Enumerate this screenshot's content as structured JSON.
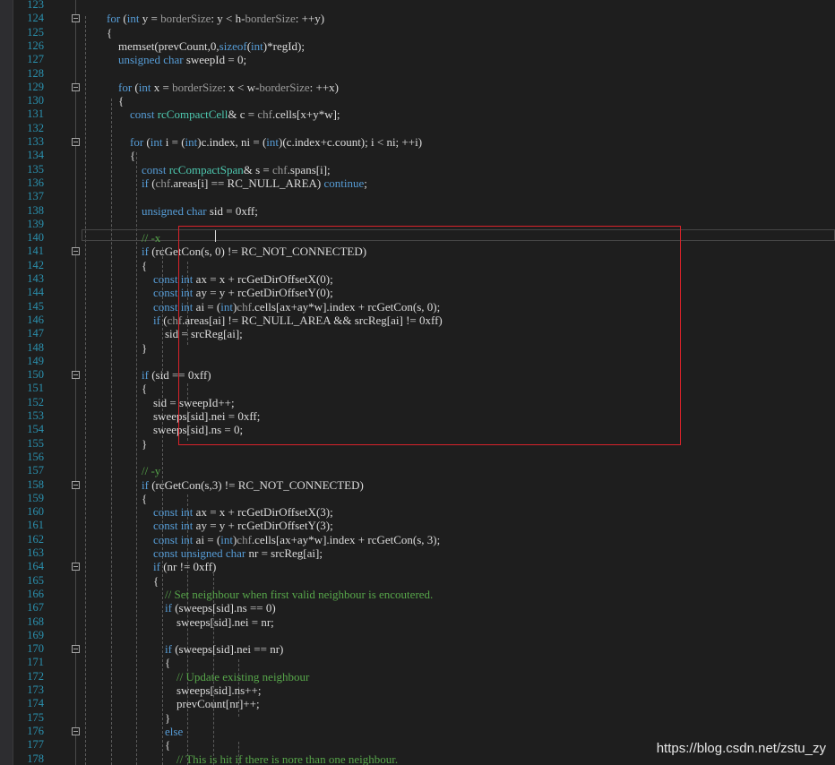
{
  "editor": {
    "colors": {
      "background": "#1e1e1e",
      "line_number": "#2b91af",
      "keyword": "#569cd6",
      "type": "#4ec9b0",
      "comment": "#57a64a",
      "member": "#9b9b9b",
      "text": "#dcdcdc",
      "highlight_border": "#d9222a"
    },
    "lines": [
      {
        "n": "123",
        "fold": false,
        "tokens": []
      },
      {
        "n": "124",
        "fold": true,
        "tokens": [
          [
            "kw",
            "for"
          ],
          [
            "fg",
            " ("
          ],
          [
            "kw",
            "int"
          ],
          [
            "fg",
            " y = "
          ],
          [
            "gv",
            "borderSize"
          ],
          [
            "fg",
            ": y < h-"
          ],
          [
            "gv",
            "borderSize"
          ],
          [
            "fg",
            ": ++y)"
          ]
        ]
      },
      {
        "n": "125",
        "fold": false,
        "tokens": [
          [
            "fg",
            "{"
          ]
        ]
      },
      {
        "n": "126",
        "fold": false,
        "tokens": [
          [
            "fg",
            "    memset(prevCount,0,"
          ],
          [
            "kw",
            "sizeof"
          ],
          [
            "fg",
            "("
          ],
          [
            "kw",
            "int"
          ],
          [
            "fg",
            ")*regId);"
          ]
        ]
      },
      {
        "n": "127",
        "fold": false,
        "tokens": [
          [
            "fg",
            "    "
          ],
          [
            "kw",
            "unsigned char"
          ],
          [
            "fg",
            " sweepId = 0;"
          ]
        ]
      },
      {
        "n": "128",
        "fold": false,
        "tokens": []
      },
      {
        "n": "129",
        "fold": true,
        "tokens": [
          [
            "fg",
            "    "
          ],
          [
            "kw",
            "for"
          ],
          [
            "fg",
            " ("
          ],
          [
            "kw",
            "int"
          ],
          [
            "fg",
            " x = "
          ],
          [
            "gv",
            "borderSize"
          ],
          [
            "fg",
            ": x < w-"
          ],
          [
            "gv",
            "borderSize"
          ],
          [
            "fg",
            ": ++x)"
          ]
        ]
      },
      {
        "n": "130",
        "fold": false,
        "tokens": [
          [
            "fg",
            "    {"
          ]
        ]
      },
      {
        "n": "131",
        "fold": false,
        "tokens": [
          [
            "fg",
            "        "
          ],
          [
            "kw",
            "const"
          ],
          [
            "fg",
            " "
          ],
          [
            "ty",
            "rcCompactCell"
          ],
          [
            "fg",
            "& c = "
          ],
          [
            "gv",
            "chf"
          ],
          [
            "fg",
            ".cells[x+y*w];"
          ]
        ]
      },
      {
        "n": "132",
        "fold": false,
        "tokens": []
      },
      {
        "n": "133",
        "fold": true,
        "tokens": [
          [
            "fg",
            "        "
          ],
          [
            "kw",
            "for"
          ],
          [
            "fg",
            " ("
          ],
          [
            "kw",
            "int"
          ],
          [
            "fg",
            " i = ("
          ],
          [
            "kw",
            "int"
          ],
          [
            "fg",
            ")c.index, ni = ("
          ],
          [
            "kw",
            "int"
          ],
          [
            "fg",
            ")(c.index+c.count); i < ni; ++i)"
          ]
        ]
      },
      {
        "n": "134",
        "fold": false,
        "tokens": [
          [
            "fg",
            "        {"
          ]
        ]
      },
      {
        "n": "135",
        "fold": false,
        "tokens": [
          [
            "fg",
            "            "
          ],
          [
            "kw",
            "const"
          ],
          [
            "fg",
            " "
          ],
          [
            "ty",
            "rcCompactSpan"
          ],
          [
            "fg",
            "& s = "
          ],
          [
            "gv",
            "chf"
          ],
          [
            "fg",
            ".spans[i];"
          ]
        ]
      },
      {
        "n": "136",
        "fold": false,
        "tokens": [
          [
            "fg",
            "            "
          ],
          [
            "kw",
            "if"
          ],
          [
            "fg",
            " ("
          ],
          [
            "gv",
            "chf"
          ],
          [
            "fg",
            ".areas[i] == RC_NULL_AREA) "
          ],
          [
            "kw",
            "continue"
          ],
          [
            "fg",
            ";"
          ]
        ]
      },
      {
        "n": "137",
        "fold": false,
        "tokens": []
      },
      {
        "n": "138",
        "fold": false,
        "tokens": [
          [
            "fg",
            "            "
          ],
          [
            "kw",
            "unsigned char"
          ],
          [
            "fg",
            " sid = 0xff;"
          ]
        ]
      },
      {
        "n": "139",
        "fold": false,
        "tokens": []
      },
      {
        "n": "140",
        "fold": false,
        "tokens": [
          [
            "fg",
            "            "
          ],
          [
            "cm",
            "// -x"
          ]
        ]
      },
      {
        "n": "141",
        "fold": true,
        "tokens": [
          [
            "fg",
            "            "
          ],
          [
            "kw",
            "if"
          ],
          [
            "fg",
            " (rcGetCon(s, 0) != RC_NOT_CONNECTED)"
          ]
        ]
      },
      {
        "n": "142",
        "fold": false,
        "tokens": [
          [
            "fg",
            "            {"
          ]
        ]
      },
      {
        "n": "143",
        "fold": false,
        "tokens": [
          [
            "fg",
            "                "
          ],
          [
            "kw",
            "const int"
          ],
          [
            "fg",
            " ax = x + rcGetDirOffsetX(0);"
          ]
        ]
      },
      {
        "n": "144",
        "fold": false,
        "tokens": [
          [
            "fg",
            "                "
          ],
          [
            "kw",
            "const int"
          ],
          [
            "fg",
            " ay = y + rcGetDirOffsetY(0);"
          ]
        ]
      },
      {
        "n": "145",
        "fold": false,
        "tokens": [
          [
            "fg",
            "                "
          ],
          [
            "kw",
            "const int"
          ],
          [
            "fg",
            " ai = ("
          ],
          [
            "kw",
            "int"
          ],
          [
            "fg",
            ")"
          ],
          [
            "gv",
            "chf"
          ],
          [
            "fg",
            ".cells[ax+ay*w].index + rcGetCon(s, 0);"
          ]
        ]
      },
      {
        "n": "146",
        "fold": false,
        "tokens": [
          [
            "fg",
            "                "
          ],
          [
            "kw",
            "if"
          ],
          [
            "fg",
            " ("
          ],
          [
            "gv",
            "chf"
          ],
          [
            "fg",
            ".areas[ai] != RC_NULL_AREA && srcReg[ai] != 0xff)"
          ]
        ]
      },
      {
        "n": "147",
        "fold": false,
        "tokens": [
          [
            "fg",
            "                    sid = srcReg[ai];"
          ]
        ]
      },
      {
        "n": "148",
        "fold": false,
        "tokens": [
          [
            "fg",
            "            }"
          ]
        ]
      },
      {
        "n": "149",
        "fold": false,
        "tokens": []
      },
      {
        "n": "150",
        "fold": true,
        "tokens": [
          [
            "fg",
            "            "
          ],
          [
            "kw",
            "if"
          ],
          [
            "fg",
            " (sid == 0xff)"
          ]
        ]
      },
      {
        "n": "151",
        "fold": false,
        "tokens": [
          [
            "fg",
            "            {"
          ]
        ]
      },
      {
        "n": "152",
        "fold": false,
        "tokens": [
          [
            "fg",
            "                sid = sweepId++;"
          ]
        ]
      },
      {
        "n": "153",
        "fold": false,
        "tokens": [
          [
            "fg",
            "                sweeps[sid].nei = 0xff;"
          ]
        ]
      },
      {
        "n": "154",
        "fold": false,
        "tokens": [
          [
            "fg",
            "                sweeps[sid].ns = 0;"
          ]
        ]
      },
      {
        "n": "155",
        "fold": false,
        "tokens": [
          [
            "fg",
            "            }"
          ]
        ]
      },
      {
        "n": "156",
        "fold": false,
        "tokens": []
      },
      {
        "n": "157",
        "fold": false,
        "tokens": [
          [
            "fg",
            "            "
          ],
          [
            "cm",
            "// -y"
          ]
        ]
      },
      {
        "n": "158",
        "fold": true,
        "tokens": [
          [
            "fg",
            "            "
          ],
          [
            "kw",
            "if"
          ],
          [
            "fg",
            " (rcGetCon(s,3) != RC_NOT_CONNECTED)"
          ]
        ]
      },
      {
        "n": "159",
        "fold": false,
        "tokens": [
          [
            "fg",
            "            {"
          ]
        ]
      },
      {
        "n": "160",
        "fold": false,
        "tokens": [
          [
            "fg",
            "                "
          ],
          [
            "kw",
            "const int"
          ],
          [
            "fg",
            " ax = x + rcGetDirOffsetX(3);"
          ]
        ]
      },
      {
        "n": "161",
        "fold": false,
        "tokens": [
          [
            "fg",
            "                "
          ],
          [
            "kw",
            "const int"
          ],
          [
            "fg",
            " ay = y + rcGetDirOffsetY(3);"
          ]
        ]
      },
      {
        "n": "162",
        "fold": false,
        "tokens": [
          [
            "fg",
            "                "
          ],
          [
            "kw",
            "const int"
          ],
          [
            "fg",
            " ai = ("
          ],
          [
            "kw",
            "int"
          ],
          [
            "fg",
            ")"
          ],
          [
            "gv",
            "chf"
          ],
          [
            "fg",
            ".cells[ax+ay*w].index + rcGetCon(s, 3);"
          ]
        ]
      },
      {
        "n": "163",
        "fold": false,
        "tokens": [
          [
            "fg",
            "                "
          ],
          [
            "kw",
            "const unsigned char"
          ],
          [
            "fg",
            " nr = srcReg[ai];"
          ]
        ]
      },
      {
        "n": "164",
        "fold": true,
        "tokens": [
          [
            "fg",
            "                "
          ],
          [
            "kw",
            "if"
          ],
          [
            "fg",
            " (nr != 0xff)"
          ]
        ]
      },
      {
        "n": "165",
        "fold": false,
        "tokens": [
          [
            "fg",
            "                {"
          ]
        ]
      },
      {
        "n": "166",
        "fold": false,
        "tokens": [
          [
            "fg",
            "                    "
          ],
          [
            "cm",
            "// Set neighbour when first valid neighbour is encoutered."
          ]
        ]
      },
      {
        "n": "167",
        "fold": false,
        "tokens": [
          [
            "fg",
            "                    "
          ],
          [
            "kw",
            "if"
          ],
          [
            "fg",
            " (sweeps[sid].ns == 0)"
          ]
        ]
      },
      {
        "n": "168",
        "fold": false,
        "tokens": [
          [
            "fg",
            "                        sweeps[sid].nei = nr;"
          ]
        ]
      },
      {
        "n": "169",
        "fold": false,
        "tokens": []
      },
      {
        "n": "170",
        "fold": true,
        "tokens": [
          [
            "fg",
            "                    "
          ],
          [
            "kw",
            "if"
          ],
          [
            "fg",
            " (sweeps[sid].nei == nr)"
          ]
        ]
      },
      {
        "n": "171",
        "fold": false,
        "tokens": [
          [
            "fg",
            "                    {"
          ]
        ]
      },
      {
        "n": "172",
        "fold": false,
        "tokens": [
          [
            "fg",
            "                        "
          ],
          [
            "cm",
            "// Update existing neighbour"
          ]
        ]
      },
      {
        "n": "173",
        "fold": false,
        "tokens": [
          [
            "fg",
            "                        sweeps[sid].ns++;"
          ]
        ]
      },
      {
        "n": "174",
        "fold": false,
        "tokens": [
          [
            "fg",
            "                        prevCount[nr]++;"
          ]
        ]
      },
      {
        "n": "175",
        "fold": false,
        "tokens": [
          [
            "fg",
            "                    }"
          ]
        ]
      },
      {
        "n": "176",
        "fold": true,
        "tokens": [
          [
            "fg",
            "                    "
          ],
          [
            "kw",
            "else"
          ]
        ]
      },
      {
        "n": "177",
        "fold": false,
        "tokens": [
          [
            "fg",
            "                    {"
          ]
        ]
      },
      {
        "n": "178",
        "fold": false,
        "tokens": [
          [
            "fg",
            "                        "
          ],
          [
            "cm",
            "// This is hit if there is nore than one neighbour."
          ]
        ]
      }
    ]
  },
  "watermark": "https://blog.csdn.net/zstu_zy"
}
